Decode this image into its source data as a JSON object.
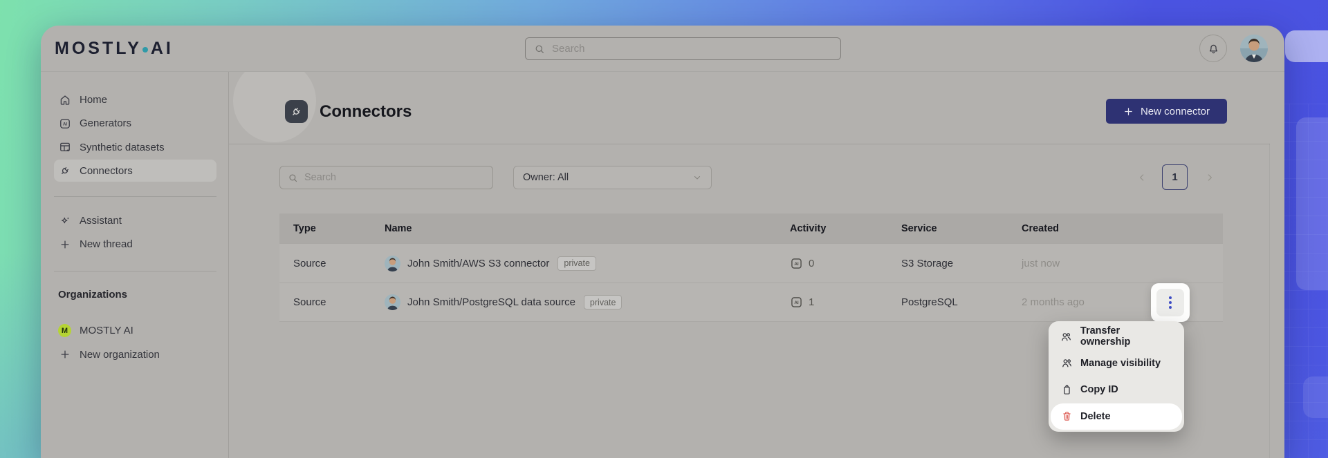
{
  "brand": {
    "word1": "MOSTLY",
    "word2": "AI"
  },
  "topbar": {
    "search_placeholder": "Search"
  },
  "sidebar": {
    "items": [
      {
        "label": "Home",
        "icon": "home-icon"
      },
      {
        "label": "Generators",
        "icon": "generators-icon"
      },
      {
        "label": "Synthetic datasets",
        "icon": "datasets-icon"
      },
      {
        "label": "Connectors",
        "icon": "plug-icon",
        "active": true
      }
    ],
    "secondary": [
      {
        "label": "Assistant",
        "icon": "sparkle-icon"
      },
      {
        "label": "New thread",
        "icon": "plus-icon"
      }
    ],
    "organizations_heading": "Organizations",
    "organizations": [
      {
        "label": "MOSTLY AI",
        "badge_letter": "M"
      }
    ],
    "new_organization_label": "New organization"
  },
  "page": {
    "title": "Connectors",
    "new_connector_label": "New connector"
  },
  "filters": {
    "search_placeholder": "Search",
    "owner_label": "Owner: All"
  },
  "pagination": {
    "current_page": "1"
  },
  "table": {
    "columns": [
      "Type",
      "Name",
      "Activity",
      "Service",
      "Created"
    ],
    "rows": [
      {
        "type": "Source",
        "name": "John Smith/AWS S3 connector",
        "visibility_badge": "private",
        "activity_count": "0",
        "service": "S3 Storage",
        "created": "just now"
      },
      {
        "type": "Source",
        "name": "John Smith/PostgreSQL data source",
        "visibility_badge": "private",
        "activity_count": "1",
        "service": "PostgreSQL",
        "created": "2 months ago"
      }
    ]
  },
  "context_menu": {
    "items": [
      {
        "label": "Transfer ownership",
        "icon": "users-icon"
      },
      {
        "label": "Manage visibility",
        "icon": "users-icon"
      },
      {
        "label": "Copy ID",
        "icon": "clipboard-icon"
      },
      {
        "label": "Delete",
        "icon": "trash-icon",
        "danger": true,
        "highlighted": true
      }
    ]
  },
  "icons": {
    "generator_glyph": "AI"
  },
  "colors": {
    "accent": "#2e3273",
    "logo-dot": "#2f9aa8",
    "org-badge": "#b5d434",
    "danger": "#dd5d55",
    "kebab-dot": "#3d4cc4",
    "window-bg": "#b3b1ae",
    "menu-bg": "#e9e8e5",
    "bg-green": "#7de1ad",
    "bg-blue": "#4b54e2"
  }
}
